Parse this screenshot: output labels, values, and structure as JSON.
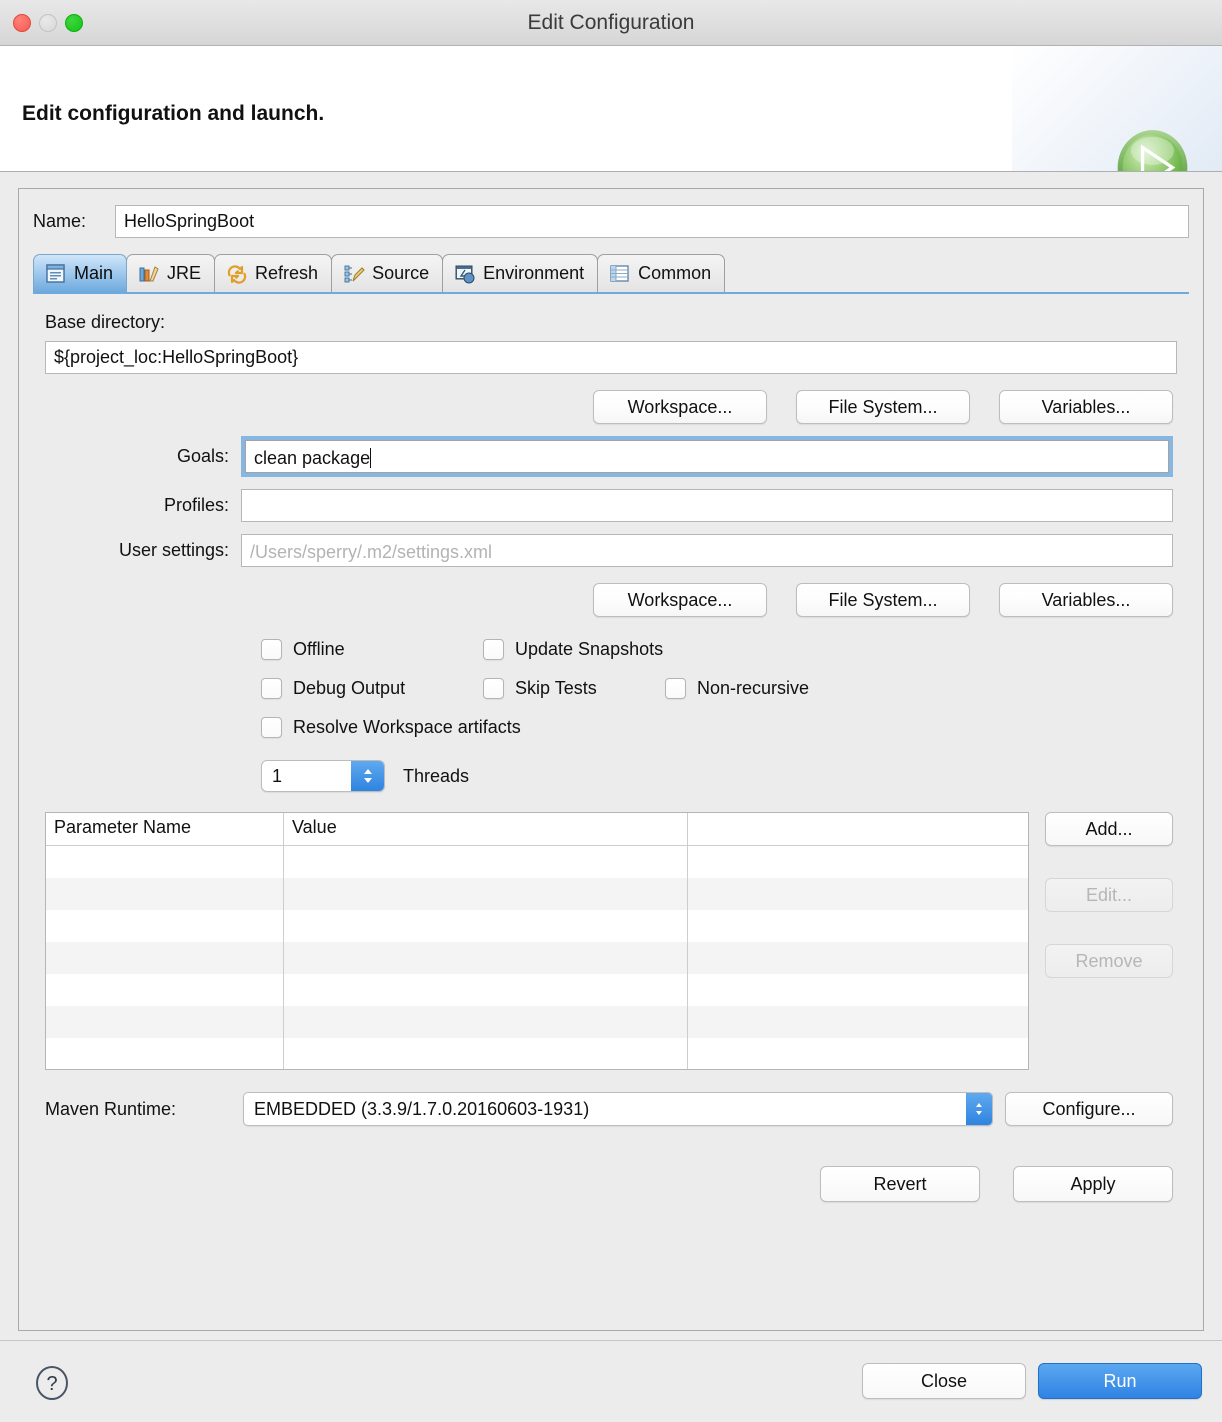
{
  "window": {
    "title": "Edit Configuration",
    "traffic_lights": [
      "close-red",
      "minimize-yellow",
      "maximize-green"
    ]
  },
  "header": {
    "title": "Edit configuration and launch.",
    "icon": "run-green-play-icon"
  },
  "name_field": {
    "label": "Name:",
    "value": "HelloSpringBoot"
  },
  "tabs": [
    {
      "label": "Main",
      "icon": "main-document-icon",
      "active": true
    },
    {
      "label": "JRE",
      "icon": "jre-books-icon",
      "active": false
    },
    {
      "label": "Refresh",
      "icon": "refresh-arrows-icon",
      "active": false
    },
    {
      "label": "Source",
      "icon": "source-pencil-icon",
      "active": false
    },
    {
      "label": "Environment",
      "icon": "environment-icon",
      "active": false
    },
    {
      "label": "Common",
      "icon": "common-table-icon",
      "active": false
    }
  ],
  "main": {
    "base_directory": {
      "label": "Base directory:",
      "value": "${project_loc:HelloSpringBoot}"
    },
    "browse_buttons_top": [
      "Workspace...",
      "File System...",
      "Variables..."
    ],
    "goals": {
      "label": "Goals:",
      "value": "clean package",
      "focused": true
    },
    "profiles": {
      "label": "Profiles:",
      "value": ""
    },
    "user_settings": {
      "label": "User settings:",
      "value": "",
      "placeholder": "/Users/sperry/.m2/settings.xml"
    },
    "browse_buttons_bottom": [
      "Workspace...",
      "File System...",
      "Variables..."
    ],
    "checkboxes": [
      {
        "label": "Offline",
        "checked": false
      },
      {
        "label": "Update Snapshots",
        "checked": false
      },
      {
        "label": "Debug Output",
        "checked": false
      },
      {
        "label": "Skip Tests",
        "checked": false
      },
      {
        "label": "Non-recursive",
        "checked": false
      },
      {
        "label": "Resolve Workspace artifacts",
        "checked": false
      }
    ],
    "threads": {
      "value": "1",
      "label": "Threads"
    },
    "parameters_table": {
      "columns": [
        "Parameter Name",
        "Value",
        ""
      ],
      "rows": []
    },
    "table_buttons": [
      {
        "label": "Add...",
        "enabled": true
      },
      {
        "label": "Edit...",
        "enabled": false
      },
      {
        "label": "Remove",
        "enabled": false
      }
    ],
    "maven_runtime": {
      "label": "Maven Runtime:",
      "value": "EMBEDDED (3.3.9/1.7.0.20160603-1931)"
    },
    "configure_button": "Configure..."
  },
  "dialog_actions": {
    "revert": "Revert",
    "apply": "Apply",
    "close": "Close",
    "run": "Run",
    "help_icon": "help-question-icon"
  },
  "colors": {
    "accent_blue": "#2f84e0",
    "tab_active_start": "#cfe6fa",
    "tab_active_end": "#6eaade",
    "window_bg": "#ececec",
    "run_green": "#6bb84a"
  }
}
